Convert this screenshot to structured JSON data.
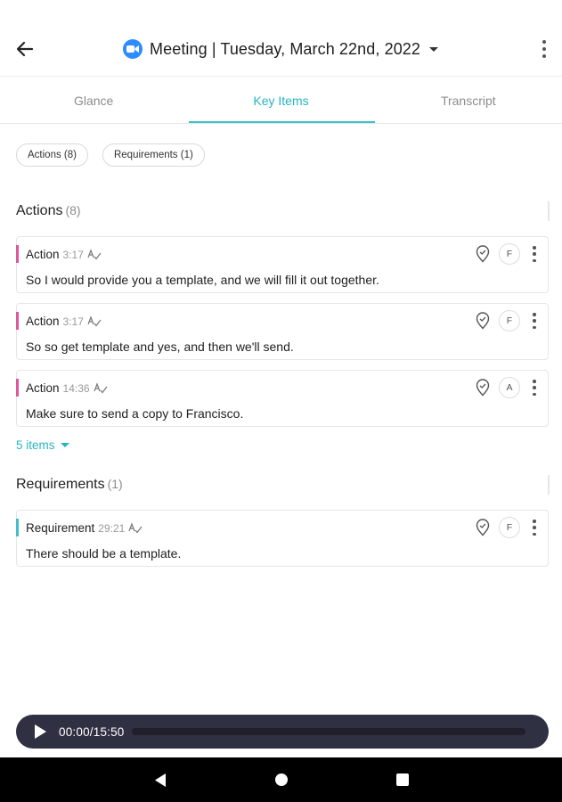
{
  "header": {
    "title": "Meeting | Tuesday, March 22nd, 2022",
    "back_icon": "arrow-left-icon",
    "app_icon": "zoom-camera-icon",
    "menu_icon": "more-vertical-icon"
  },
  "tabs": [
    {
      "label": "Glance",
      "active": false
    },
    {
      "label": "Key Items",
      "active": true
    },
    {
      "label": "Transcript",
      "active": false
    }
  ],
  "filters": [
    {
      "label": "Actions (8)"
    },
    {
      "label": "Requirements (1)"
    }
  ],
  "sections": {
    "actions": {
      "title": "Actions",
      "count": "(8)",
      "items": [
        {
          "type": "Action",
          "time": "3:17",
          "assignee": "F",
          "text": "So I would provide you a template, and we will fill it out together."
        },
        {
          "type": "Action",
          "time": "3:17",
          "assignee": "F",
          "text": "So so get template and yes, and then we'll send."
        },
        {
          "type": "Action",
          "time": "14:36",
          "assignee": "A",
          "text": "Make sure to send a copy to Francisco."
        }
      ],
      "more_label": "5 items"
    },
    "requirements": {
      "title": "Requirements",
      "count": "(1)",
      "items": [
        {
          "type": "Requirement",
          "time": "29:21",
          "assignee": "F",
          "text": "There should be a template."
        }
      ]
    }
  },
  "player": {
    "time": "00:00/15:50",
    "progress": 0
  },
  "colors": {
    "accent": "#26b5c2",
    "action_marker": "#e0569b",
    "requirement_marker": "#3cc1cc",
    "player_bg": "#2f3142"
  }
}
